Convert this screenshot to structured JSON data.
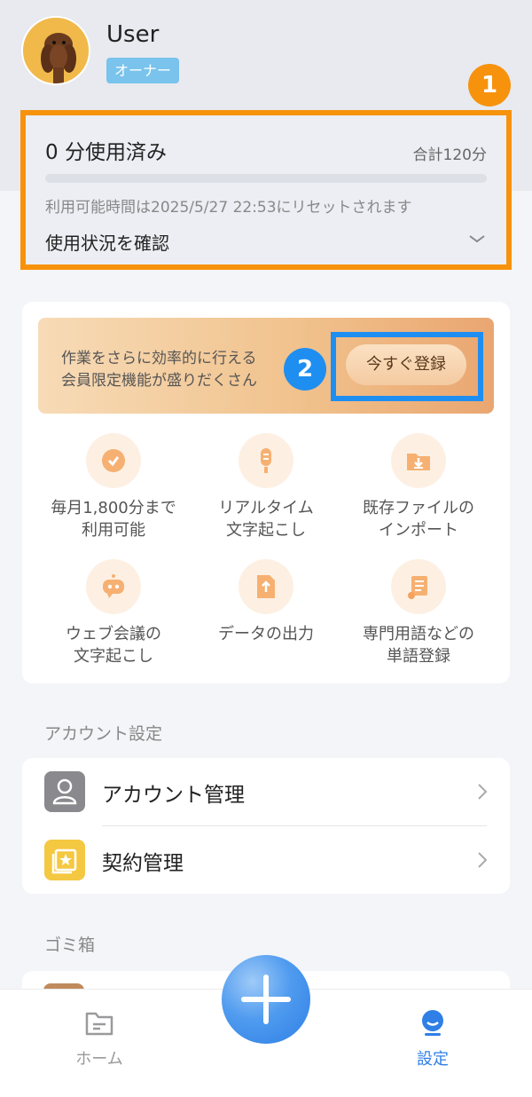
{
  "profile": {
    "username": "User",
    "role_badge": "オーナー"
  },
  "markers": {
    "one": "1",
    "two": "2"
  },
  "usage": {
    "used_label": "0 分使用済み",
    "total_label": "合計120分",
    "progress_fraction": 0,
    "reset_text": "利用可能時間は2025/5/27 22:53にリセットされます",
    "check_label": "使用状況を確認"
  },
  "promo": {
    "line1": "作業をさらに効率的に行える",
    "line2": "会員限定機能が盛りだくさん",
    "register_button": "今すぐ登録"
  },
  "features": [
    {
      "label": "毎月1,800分まで\n利用可能",
      "icon": "clock-icon"
    },
    {
      "label": "リアルタイム\n文字起こし",
      "icon": "microphone-icon"
    },
    {
      "label": "既存ファイルの\nインポート",
      "icon": "folder-import-icon"
    },
    {
      "label": "ウェブ会議の\n文字起こし",
      "icon": "robot-icon"
    },
    {
      "label": "データの出力",
      "icon": "file-export-icon"
    },
    {
      "label": "専門用語などの\n単語登録",
      "icon": "scroll-icon"
    }
  ],
  "account_settings": {
    "title": "アカウント設定",
    "items": [
      {
        "label": "アカウント管理",
        "icon": "person-icon"
      },
      {
        "label": "契約管理",
        "icon": "contract-icon"
      }
    ]
  },
  "trash": {
    "title": "ゴミ箱"
  },
  "nav": {
    "home": "ホーム",
    "settings": "設定"
  },
  "colors": {
    "accent_orange": "#f7920d",
    "accent_blue": "#1f8ef1",
    "badge_blue": "#79c3ec",
    "active_nav": "#2f7fe6"
  }
}
